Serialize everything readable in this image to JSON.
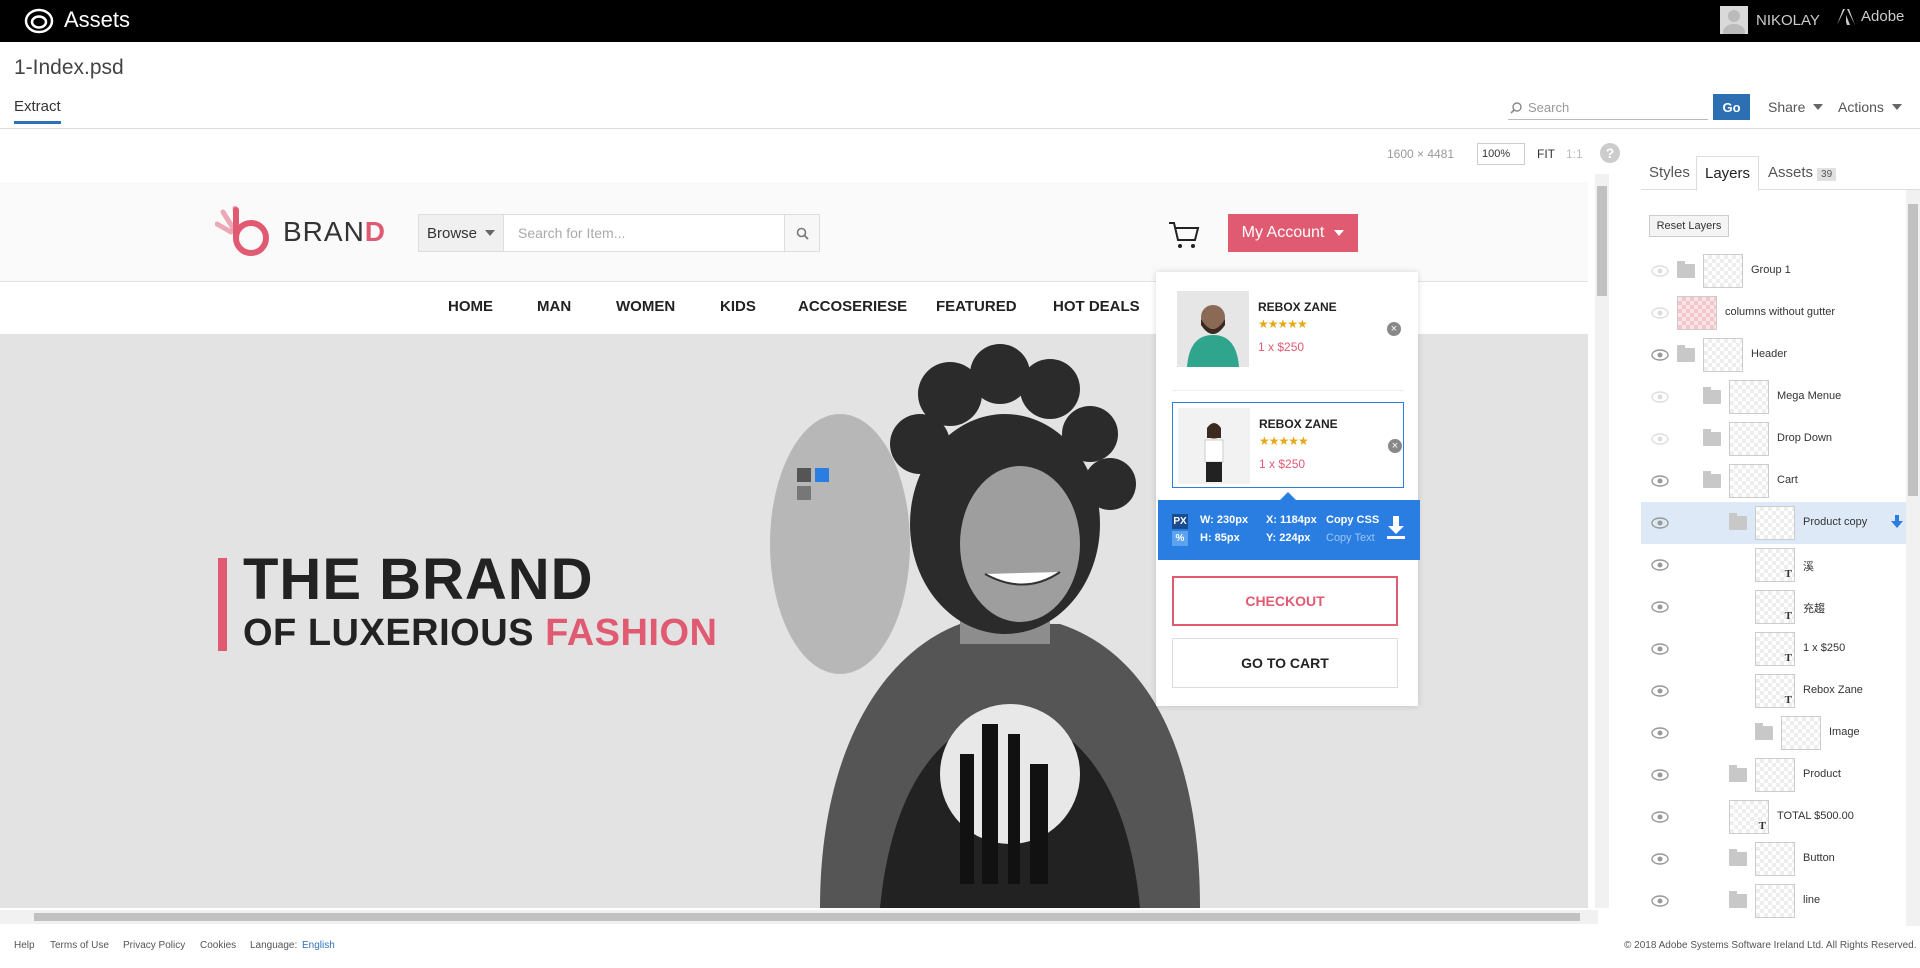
{
  "app": {
    "title": "Assets",
    "user": "NIKOLAY",
    "vendor": "Adobe"
  },
  "document": {
    "filename": "1-Index.psd",
    "tab": "Extract"
  },
  "toolbar": {
    "search_placeholder": "Search",
    "go": "Go",
    "share": "Share",
    "actions": "Actions"
  },
  "canvas_info": {
    "dimensions": "1600 × 4481",
    "zoom": "100%",
    "fit": "FIT",
    "one_to_one": "1:1",
    "help": "?"
  },
  "site": {
    "brand": {
      "text": "BRAN",
      "accent": "D"
    },
    "browse": "Browse",
    "search_placeholder": "Search for Item...",
    "account": "My Account",
    "nav": [
      "HOME",
      "MAN",
      "WOMEN",
      "KIDS",
      "ACCOSERIESE",
      "FEATURED",
      "HOT DEALS"
    ],
    "hero": {
      "line1": "THE BRAND",
      "line2": "OF LUXERIOUS ",
      "line2_accent": "FASHION"
    },
    "cart": {
      "items": [
        {
          "name": "REBOX ZANE",
          "stars": "★★★★★",
          "price": "1 x  $250",
          "remove": "×"
        },
        {
          "name": "REBOX ZANE",
          "stars": "★★★★★",
          "price": "1 x  $250",
          "remove": "×"
        }
      ],
      "checkout": "CHECKOUT",
      "go_to_cart": "GO TO CART"
    }
  },
  "measure": {
    "px": "PX",
    "pct": "%",
    "w": "W: 230px",
    "h": "H: 85px",
    "x": "X: 1184px",
    "y": "Y: 224px",
    "copy_css": "Copy CSS",
    "copy_text": "Copy Text"
  },
  "panel": {
    "tabs": {
      "styles": "Styles",
      "layers": "Layers",
      "assets": "Assets",
      "assets_count": "39"
    },
    "reset": "Reset Layers",
    "layers": [
      {
        "name": "Group 1"
      },
      {
        "name": "columns without gutter"
      },
      {
        "name": "Header"
      },
      {
        "name": "Mega Menue"
      },
      {
        "name": "Drop Down"
      },
      {
        "name": "Cart"
      },
      {
        "name": "Product copy"
      },
      {
        "name": "溪"
      },
      {
        "name": "充趨"
      },
      {
        "name": "1 x $250"
      },
      {
        "name": "Rebox Zane"
      },
      {
        "name": "Image"
      },
      {
        "name": "Product"
      },
      {
        "name": "TOTAL $500.00"
      },
      {
        "name": "Button"
      },
      {
        "name": "line"
      }
    ]
  },
  "footer": {
    "help": "Help",
    "terms": "Terms of Use",
    "privacy": "Privacy Policy",
    "cookies": "Cookies",
    "language_label": "Language:",
    "language": "English",
    "copyright": "© 2018 Adobe Systems Software Ireland Ltd. All Rights Reserved."
  },
  "colors": {
    "accent_pink": "#e05a72",
    "select_blue": "#2a7de1",
    "go_blue": "#2d6fb3"
  }
}
